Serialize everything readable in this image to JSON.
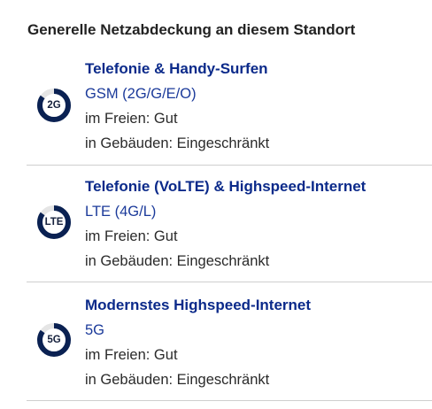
{
  "heading": "Generelle Netzabdeckung an diesem Standort",
  "colors": {
    "title": "#0b2a8a",
    "tech": "#1b3a9a",
    "gauge_fill": "#0a2152",
    "gauge_track": "#e5e5e5",
    "divider": "#cfcfcf"
  },
  "items": [
    {
      "badge": "2G",
      "icon": "signal-gauge-icon",
      "coverage_level": 0.85,
      "title": "Telefonie & Handy-Surfen",
      "tech": "GSM (2G/G/E/O)",
      "outdoor": "im Freien: Gut",
      "indoor": "in Gebäuden: Eingeschränkt"
    },
    {
      "badge": "LTE",
      "icon": "signal-gauge-icon",
      "coverage_level": 0.85,
      "title": "Telefonie (VoLTE) & Highspeed-Internet",
      "tech": "LTE (4G/L)",
      "outdoor": "im Freien: Gut",
      "indoor": "in Gebäuden: Eingeschränkt"
    },
    {
      "badge": "5G",
      "icon": "signal-gauge-icon",
      "coverage_level": 0.85,
      "title": "Modernstes Highspeed-Internet",
      "tech": "5G",
      "outdoor": "im Freien: Gut",
      "indoor": "in Gebäuden: Eingeschränkt"
    }
  ]
}
